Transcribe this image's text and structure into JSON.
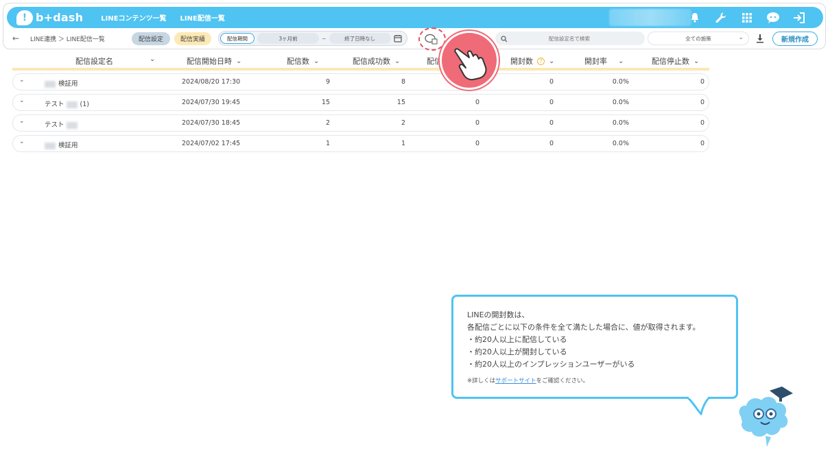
{
  "app": {
    "logo_text": "b+dash"
  },
  "topnav": {
    "items": [
      "LINEコンテンツ一覧",
      "LINE配信一覧"
    ]
  },
  "toolbar": {
    "breadcrumb": "LINE連携 ＞ LINE配信一覧",
    "tab_setting": "配信設定",
    "tab_actual": "配信実績",
    "period_label": "配信期間",
    "period_from": "3ヶ月前",
    "period_sep": "~",
    "period_to": "終了日時なし",
    "search_placeholder": "配信設定名で検索",
    "measure_select": "全ての施策",
    "new_button": "新規作成"
  },
  "table": {
    "headers": [
      "配信設定名",
      "配信開始日時",
      "配信数",
      "配信成功数",
      "配信",
      "開封数",
      "開封率",
      "配信停止数"
    ],
    "rows": [
      {
        "name": "検証用",
        "date": "2024/08/20 17:30",
        "sent": "9",
        "success": "8",
        "col5": "",
        "opens": "0",
        "rate": "0.0%",
        "stops": "0"
      },
      {
        "name_prefix": "テスト",
        "name_suffix": "(1)",
        "date": "2024/07/30 19:45",
        "sent": "15",
        "success": "15",
        "col5": "0",
        "opens": "0",
        "rate": "0.0%",
        "stops": "0"
      },
      {
        "name_prefix": "テスト",
        "date": "2024/07/30 18:45",
        "sent": "2",
        "success": "2",
        "col5": "0",
        "opens": "0",
        "rate": "0.0%",
        "stops": "0"
      },
      {
        "name": "検証用",
        "date": "2024/07/02 17:45",
        "sent": "1",
        "success": "1",
        "col5": "0",
        "opens": "0",
        "rate": "0.0%",
        "stops": "0"
      }
    ]
  },
  "tooltip": {
    "line1": "LINEの開封数は、",
    "line2": "各配信ごとに以下の条件を全て満たした場合に、値が取得されます。",
    "line3": "・約20人以上に配信している",
    "line4": "・約20人以上が開封している",
    "line5": "・約20人以上のインプレッションユーザーがいる",
    "note_prefix": "※詳しくは",
    "note_link": "サポートサイト",
    "note_suffix": "をご確認ください。"
  },
  "colors": {
    "brand": "#4fc3f2",
    "accent": "#ef6b77",
    "highlight": "#fbe7b3"
  }
}
